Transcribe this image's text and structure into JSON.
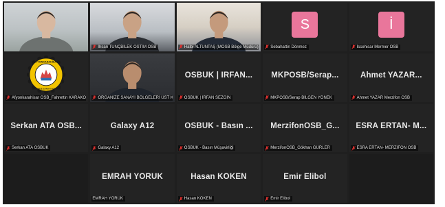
{
  "colors": {
    "grid_bg": "#1f1f1f",
    "tile_bg": "#232323",
    "speaker_outline": "#bfe36a",
    "avatar_pink": "#e9769b",
    "muted_mic": "#e0312f"
  },
  "participants": [
    {
      "label": "",
      "display": "",
      "kind": "video",
      "scene": "v1",
      "speaking": true
    },
    {
      "label": "İhsan TUNÇBİLEK OSTİM OSB",
      "kind": "video",
      "scene": "v2"
    },
    {
      "label": "Halbi ALTUNTAŞ (MOSB Bölge Müdürü)",
      "kind": "video",
      "scene": "v3"
    },
    {
      "label": "Sebahattin Dönmez",
      "kind": "avatar",
      "initial": "S"
    },
    {
      "label": "İscehisar Mermer OSB",
      "kind": "avatar",
      "initial": "İ"
    },
    {
      "label": "Afyonkarahisar OSB_Fahrettin KARAKOL",
      "kind": "logo",
      "logo_text_top": "AFYONKARAHİSAR",
      "logo_text_bottom": "ORGANİZE SANAYİ BÖLGESİ"
    },
    {
      "label": "ORGANİZE SANAYİ BÖLGELERİ ÜST KURUL...",
      "kind": "video",
      "scene": "v5"
    },
    {
      "label": "OSBÜK | İRFAN SEZGİN",
      "display": "OSBÜK | İRFAN...",
      "kind": "name"
    },
    {
      "label": "MKPOSB/Serap BİLGEN YÖNEK",
      "display": "MKPOSB/Serap...",
      "kind": "name"
    },
    {
      "label": "Ahmet YAZAR Merzifon OSB",
      "display": "Ahmet YAZAR...",
      "kind": "name"
    },
    {
      "label": "Serkan ATA OSBÜK",
      "display": "Serkan ATA OSB...",
      "kind": "name"
    },
    {
      "label": "Galaxy A12",
      "display": "Galaxy A12",
      "kind": "name"
    },
    {
      "label": "OSBÜK - Basın Müşavirliği",
      "display": "OSBÜK - Basın ...",
      "kind": "name"
    },
    {
      "label": "MerzifonOSB_Gökhan GÜRLER",
      "display": "MerzifonOSB_G...",
      "kind": "name"
    },
    {
      "label": "ESRA ERTAN- MERZİFON OSB",
      "display": "ESRA ERTAN- M...",
      "kind": "name"
    },
    {
      "label": "",
      "display": "",
      "kind": "empty"
    },
    {
      "label": "EMRAH YÖRÜK",
      "display": "EMRAH YÖRÜK",
      "kind": "name",
      "mic": false
    },
    {
      "label": "Hasan KÖKEN",
      "display": "Hasan KÖKEN",
      "kind": "name"
    },
    {
      "label": "Emir Elibol",
      "display": "Emir Elibol",
      "kind": "name"
    },
    {
      "label": "",
      "display": "",
      "kind": "empty"
    }
  ]
}
